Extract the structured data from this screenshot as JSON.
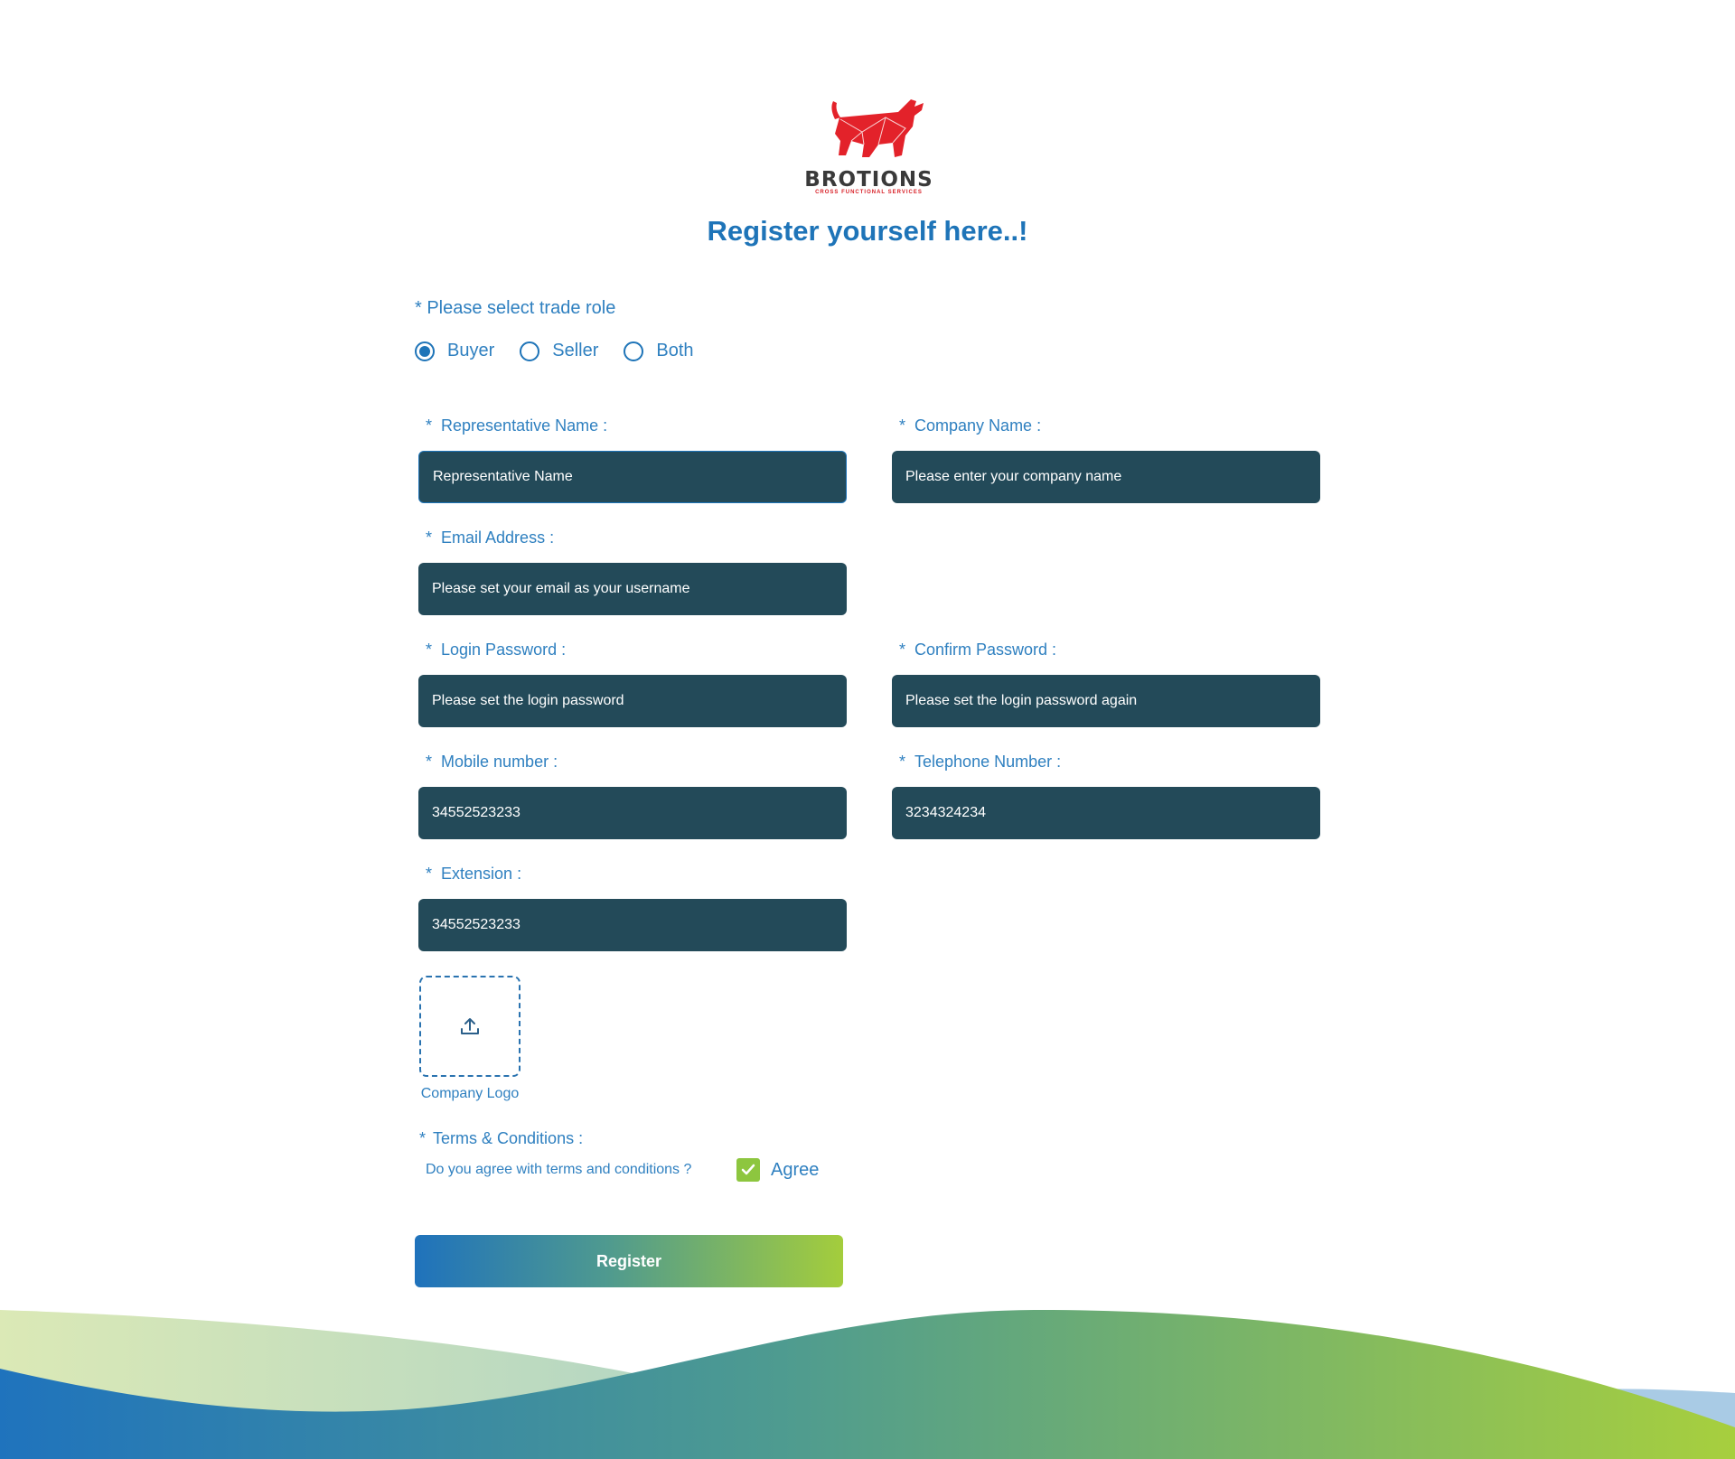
{
  "brand": {
    "name": "BROTIONS",
    "tagline": "CROSS FUNCTIONAL SERVICES",
    "logo_color": "#d81f26"
  },
  "heading": "Register yourself here..!",
  "trade_role": {
    "label": "* Please select trade role",
    "options": [
      {
        "label": "Buyer",
        "selected": true
      },
      {
        "label": "Seller",
        "selected": false
      },
      {
        "label": "Both",
        "selected": false
      }
    ]
  },
  "fields": {
    "representative_name": {
      "label": "Representative Name :",
      "value": "Representative Name"
    },
    "company_name": {
      "label": "Company Name :",
      "placeholder": "Please enter your company name"
    },
    "email": {
      "label": "Email Address :",
      "placeholder": "Please set your email as your username"
    },
    "login_password": {
      "label": "Login Password :",
      "placeholder": "Please set the login password"
    },
    "confirm_password": {
      "label": "Confirm Password :",
      "placeholder": "Please set the login password again"
    },
    "mobile": {
      "label": "Mobile number :",
      "value": "34552523233"
    },
    "telephone": {
      "label": "Telephone Number :",
      "value": "3234324234"
    },
    "extension": {
      "label": "Extension :",
      "value": "34552523233"
    }
  },
  "required_marker": "*",
  "upload": {
    "icon": "upload-icon",
    "caption": "Company Logo"
  },
  "terms": {
    "label": "Terms & Conditions :",
    "question": "Do you agree with terms and conditions ?",
    "agree_label": "Agree",
    "checked": true
  },
  "register_label": "Register",
  "colors": {
    "primary": "#1e74b8",
    "field_bg": "#234a59",
    "accent_green": "#8dc63f"
  }
}
